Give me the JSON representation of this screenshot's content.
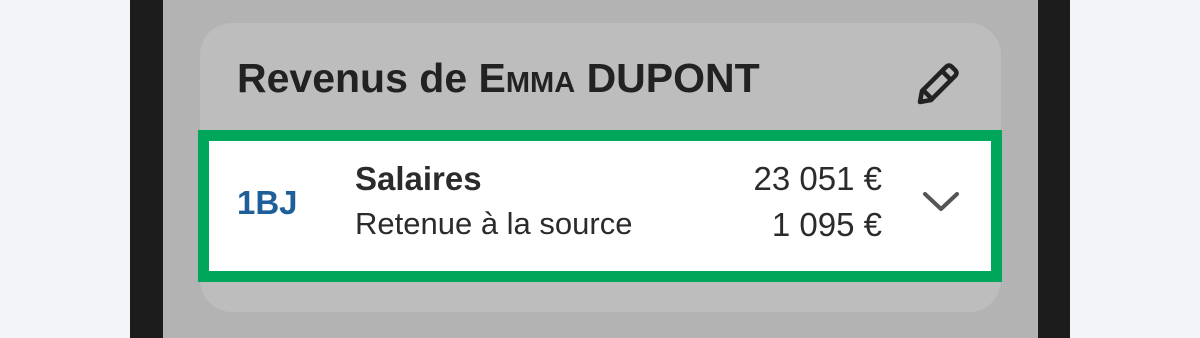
{
  "card": {
    "title_prefix": "Revenus de ",
    "title_first_name": "Emma",
    "title_last_name": "DUPONT",
    "edit_icon": "pencil-icon"
  },
  "income_row": {
    "code": "1BJ",
    "label": "Salaires",
    "amount": "23 051 €",
    "sublabel": "Retenue à la source",
    "subamount": "1 095 €",
    "expand_icon": "chevron-down-icon",
    "highlight_color": "#00a65a",
    "code_color": "#1f5f99"
  }
}
